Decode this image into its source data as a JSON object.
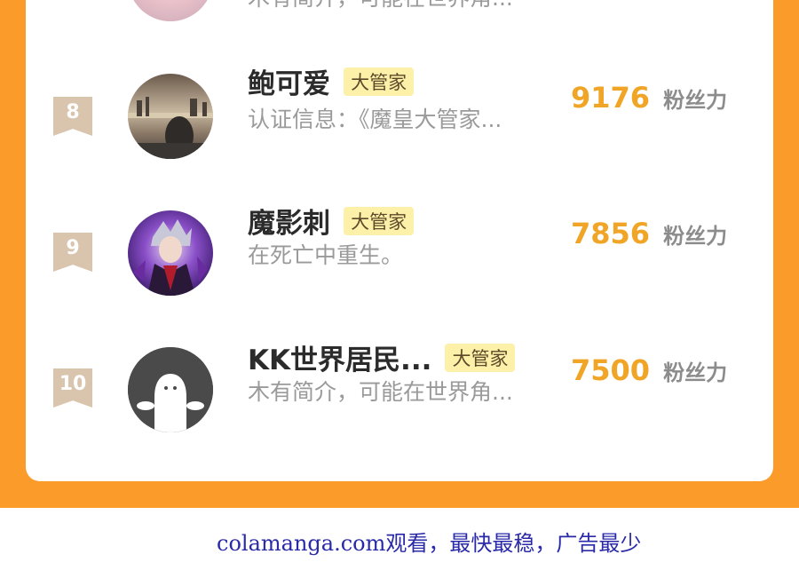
{
  "ranking": {
    "partial_row": {
      "desc": "木有简介，可能在世界角..."
    },
    "rows": [
      {
        "rank": "8",
        "avatar": "avatar-photo-city-window",
        "name": "鲍可爱",
        "badge": "大管家",
        "desc": "认证信息：《魔皇大管家...",
        "score": "9176",
        "unit": "粉丝力"
      },
      {
        "rank": "9",
        "avatar": "avatar-purple-anime-character",
        "name": "魔影刺",
        "badge": "大管家",
        "desc": "在死亡中重生。",
        "score": "7856",
        "unit": "粉丝力"
      },
      {
        "rank": "10",
        "avatar": "avatar-default-ghost",
        "name": "KK世界居民...",
        "badge": "大管家",
        "desc": "木有简介，可能在世界角...",
        "score": "7500",
        "unit": "粉丝力"
      }
    ]
  },
  "footer": {
    "watermark": "colamanga.com观看，最快最稳，广告最少"
  },
  "colors": {
    "frame": "#fb9b2a",
    "score": "#f0a526",
    "badge_bg": "#fdf0a8",
    "rank_bg": "#d9c4ae",
    "watermark": "#2a2aa8"
  }
}
